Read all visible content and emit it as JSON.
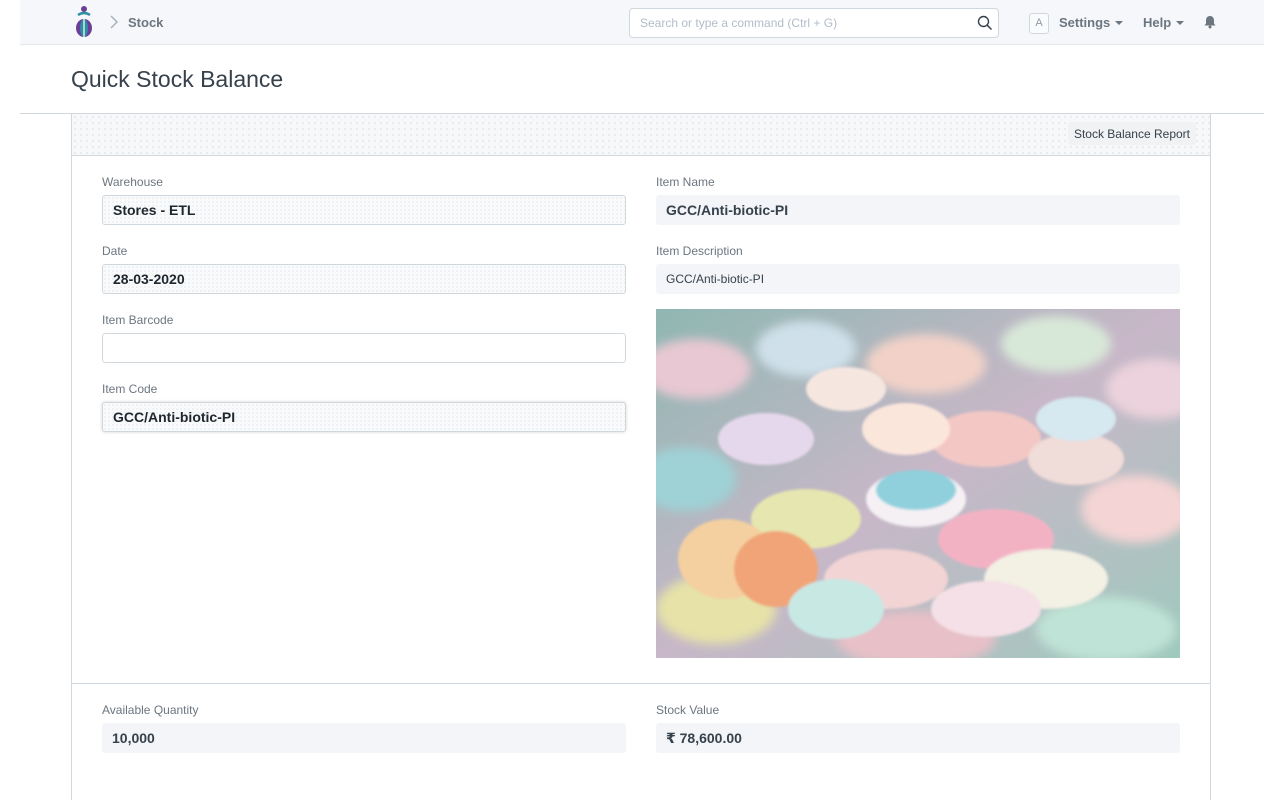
{
  "navbar": {
    "breadcrumb": "Stock",
    "search_placeholder": "Search or type a command (Ctrl + G)",
    "avatar_letter": "A",
    "settings_label": "Settings",
    "help_label": "Help"
  },
  "page": {
    "title": "Quick Stock Balance"
  },
  "toolbar": {
    "report_button": "Stock Balance Report"
  },
  "form": {
    "warehouse": {
      "label": "Warehouse",
      "value": "Stores - ETL"
    },
    "date": {
      "label": "Date",
      "value": "28-03-2020"
    },
    "item_barcode": {
      "label": "Item Barcode",
      "value": ""
    },
    "item_code": {
      "label": "Item Code",
      "value": "GCC/Anti-biotic-PI"
    },
    "item_name": {
      "label": "Item Name",
      "value": "GCC/Anti-biotic-PI"
    },
    "item_description": {
      "label": "Item Description",
      "value": "GCC/Anti-biotic-PI"
    }
  },
  "summary": {
    "available_quantity": {
      "label": "Available Quantity",
      "value": "10,000"
    },
    "stock_value": {
      "label": "Stock Value",
      "value": "₹ 78,600.00"
    }
  },
  "colors": {
    "navbar_bg": "#f5f7fa",
    "text": "#36414c",
    "muted_text": "#6c7680",
    "border": "#d1d8dd",
    "readonly_bg": "#f3f5f8",
    "logo_purple": "#6b3f97",
    "logo_teal": "#2e8fa3"
  },
  "icons": [
    "app-logo-icon",
    "chevron-right-icon",
    "search-icon",
    "caret-down-icon",
    "bell-icon"
  ]
}
